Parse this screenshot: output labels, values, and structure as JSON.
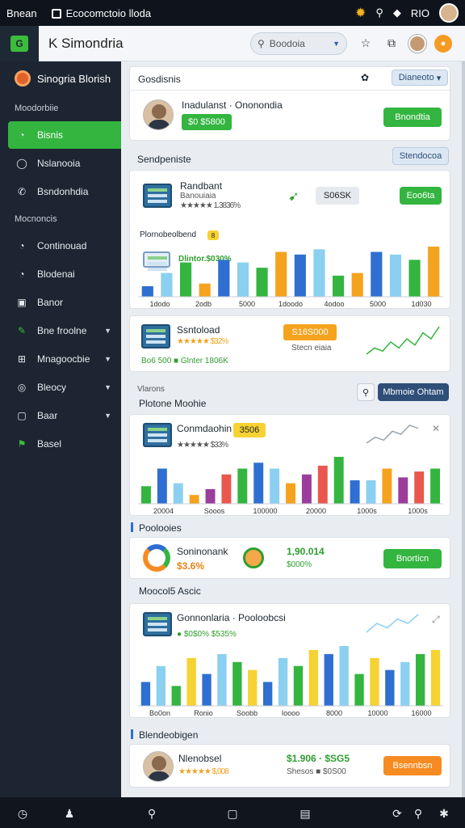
{
  "statusbar": {
    "carrier": "Bnean",
    "tab_title": "Ecocomctoio lloda",
    "right_text": "RIO"
  },
  "appbar": {
    "logo_text": "G",
    "title": "K Simondria",
    "search_value": "Boodoia"
  },
  "sidebar": {
    "brand": "Sinogria Blorish",
    "section1": "Moodorbiie",
    "items_top": [
      {
        "label": "Bisnis",
        "icon": "chat-icon",
        "active": true
      },
      {
        "label": "Nslanooia",
        "icon": "circle-icon"
      },
      {
        "label": "Bsndonhdia",
        "icon": "phone-icon"
      }
    ],
    "section2": "Mocnoncis",
    "items_bottom": [
      {
        "label": "Continouad",
        "icon": "chat-icon"
      },
      {
        "label": "Blodenai",
        "icon": "chat-icon"
      },
      {
        "label": "Banor",
        "icon": "square-icon"
      },
      {
        "label": "Bne froolne",
        "icon": "pen-icon",
        "caret": true
      },
      {
        "label": "Mnagoocbie",
        "icon": "grid-icon",
        "caret": true
      },
      {
        "label": "Bleocy",
        "icon": "compass-icon",
        "caret": true
      },
      {
        "label": "Baar",
        "icon": "square-icon",
        "caret": true
      },
      {
        "label": "Basel",
        "icon": "flag-icon"
      }
    ]
  },
  "main": {
    "card1": {
      "header": "Gosdisnis",
      "header_pill": "Dianeoto",
      "name": "Inadulanst · Ononondia",
      "amount": "$0 $5800",
      "button": "Bnondtia"
    },
    "section_title": "Sendpeniste",
    "section_pill": "Stendocoa",
    "card2": {
      "name": "Randbant",
      "subname": "Banouiaia",
      "rating_text": "★★★★★ 1.3836%",
      "badge": "S06SK",
      "button": "Eoo6ta",
      "chart_label": "Plornobeolbend",
      "chart_badge": "8",
      "info_text": "Dlintor.$030%",
      "chart_data": {
        "type": "bar",
        "categories": [
          "1dodo",
          "2odb",
          "5000",
          "1doodo",
          "4odoo",
          "5000",
          "1d030"
        ],
        "values": [
          4,
          9,
          13,
          5,
          14,
          13,
          11,
          17,
          16,
          18,
          8,
          9,
          17,
          16,
          14,
          19
        ],
        "colors": [
          "#2e6fd1",
          "#8bd0f0",
          "#33b540",
          "#f5a31e"
        ]
      }
    },
    "card3": {
      "name": "Ssntoload",
      "rating_text": "★★★★★ $32%",
      "subtext": "Bo6 500 ■ Glnter 1806K",
      "badge": "S16S000",
      "badge_sub": "Stecn eiaia",
      "spark": [
        2,
        4,
        3,
        6,
        4,
        7,
        5,
        9,
        7,
        11
      ]
    },
    "section2_label": "Vlarons",
    "section2_title": "Plotone Moohie",
    "section2_pill": "Mbmoie Ohtam",
    "card4": {
      "name": "Conmdaohin",
      "badge": "3506",
      "rating_text": "★★★★★ $33%",
      "chart_data": {
        "type": "bar",
        "categories": [
          "20004",
          "Sooos",
          "100000",
          "20000",
          "1000s",
          "1000s"
        ],
        "values": [
          6,
          12,
          7,
          3,
          5,
          10,
          12,
          14,
          12,
          7,
          10,
          13,
          16,
          8,
          8,
          12,
          9,
          11,
          12
        ],
        "colors": [
          "#33b540",
          "#2e6fd1",
          "#8bd0f0",
          "#f5a31e",
          "#9b3d9b",
          "#e8584e"
        ]
      },
      "spark": [
        3,
        5,
        4,
        7,
        6,
        9,
        8
      ]
    },
    "section3_title": "Poolooies",
    "card5": {
      "name": "Soninonank",
      "pct": "$3.6%",
      "amount": "1,90.014",
      "amount_sub": "$000%",
      "button": "Bnorticn"
    },
    "section4_title": "Moocol5 Ascic",
    "card6": {
      "name": "Gonnonlaria · Pooloobcsi",
      "rating_text": "● $0$0% $535%",
      "chart_data": {
        "type": "bar",
        "categories": [
          "Bo0on",
          "Ronio",
          "Soobb",
          "Ioooo",
          "8000",
          "10000",
          "16000"
        ],
        "values": [
          6,
          10,
          5,
          12,
          8,
          13,
          11,
          9,
          6,
          12,
          10,
          14,
          13,
          15,
          8,
          12,
          9,
          11,
          13,
          14
        ],
        "colors": [
          "#2e6fd1",
          "#8bd0f0",
          "#33b540",
          "#f6d233"
        ]
      },
      "spark": [
        2,
        4,
        3,
        5,
        4,
        6
      ]
    },
    "section5_title": "Blendeobigen",
    "card7": {
      "name": "Nlenobsel",
      "rating_text": "★★★★★ $,008",
      "amount": "$1.906 · $SG5",
      "sub": "Shesos ■ $0S00",
      "button": "Bsennbsn"
    }
  },
  "bottomnav": [
    "clock-icon",
    "person-icon",
    "search-icon",
    "square-icon",
    "card-icon",
    "refresh-icon",
    "search-icon",
    "grid-icon"
  ]
}
